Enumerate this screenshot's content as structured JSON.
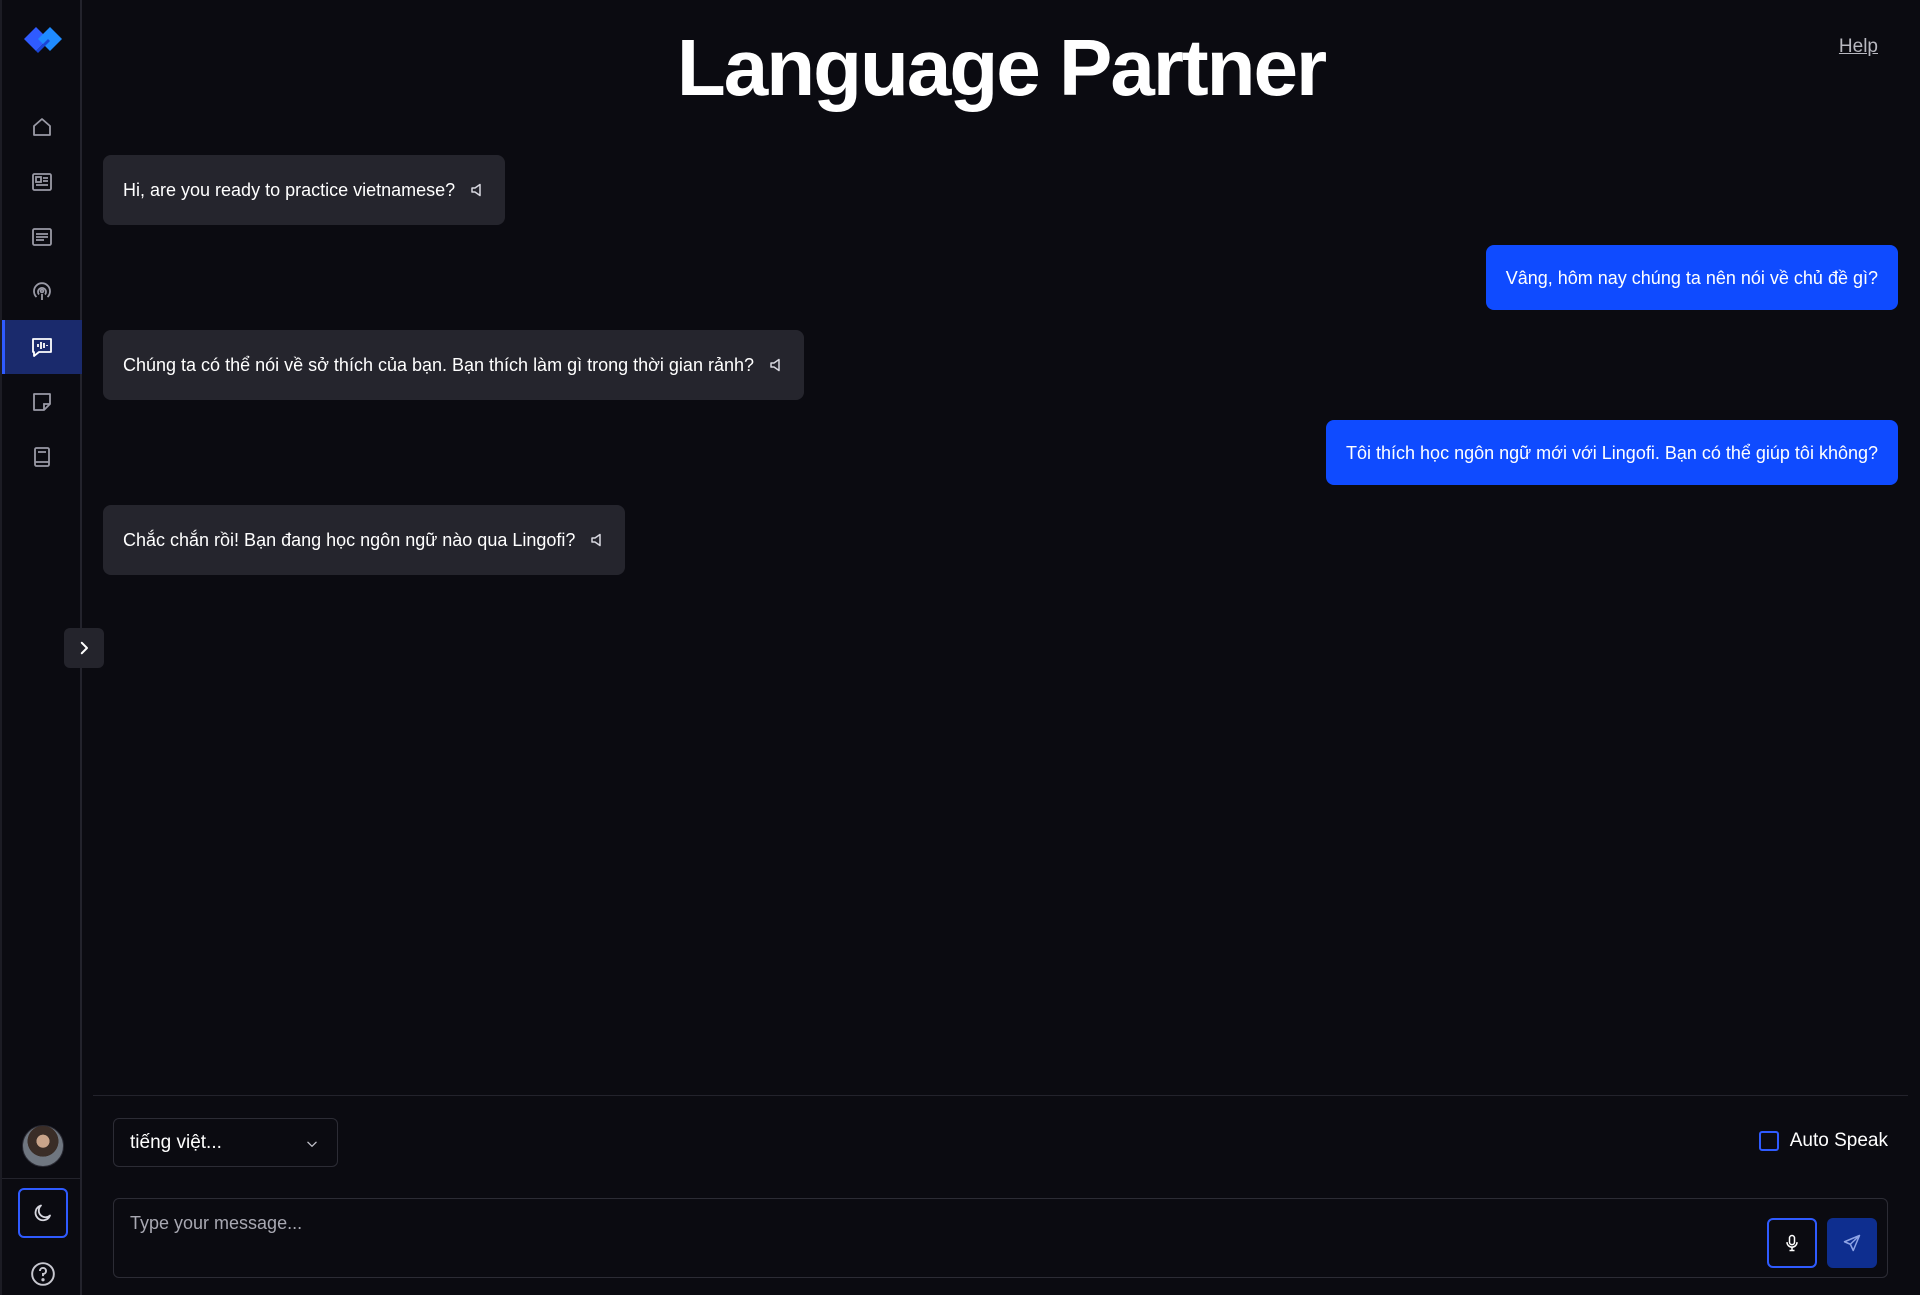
{
  "header": {
    "title": "Language Partner",
    "help_label": "Help"
  },
  "sidebar": {
    "items": [
      {
        "name": "home"
      },
      {
        "name": "news"
      },
      {
        "name": "articles"
      },
      {
        "name": "podcast"
      },
      {
        "name": "language-partner",
        "active": true
      },
      {
        "name": "notes"
      },
      {
        "name": "dictionary"
      }
    ],
    "accent_color": "#2f5bff"
  },
  "messages": [
    {
      "role": "assistant",
      "text": "Hi, are you ready to practice vietnamese?"
    },
    {
      "role": "user",
      "text": "Vâng, hôm nay chúng ta nên nói về chủ đề gì?"
    },
    {
      "role": "assistant",
      "text": "Chúng ta có thể nói về sở thích của bạn. Bạn thích làm gì trong thời gian rảnh?"
    },
    {
      "role": "user",
      "text": "Tôi thích học ngôn ngữ mới với Lingofi. Bạn có thể giúp tôi không?"
    },
    {
      "role": "assistant",
      "text": "Chắc chắn rồi! Bạn đang học ngôn ngữ nào qua Lingofi?"
    }
  ],
  "composer": {
    "language_selected": "tiếng việt...",
    "auto_speak_label": "Auto Speak",
    "auto_speak_checked": false,
    "placeholder": "Type your message..."
  },
  "colors": {
    "background": "#0b0b11",
    "bot_bubble": "#25252d",
    "user_bubble": "#0f4bff"
  }
}
